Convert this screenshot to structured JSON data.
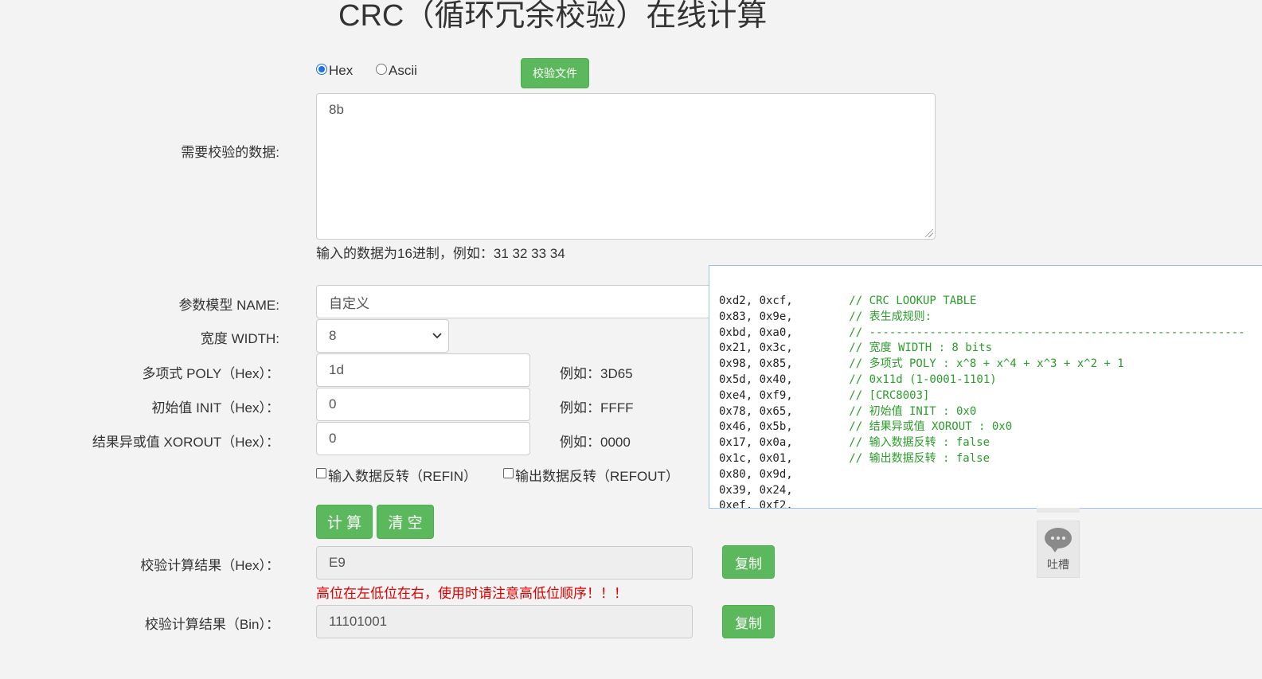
{
  "page": {
    "title": "CRC（循环冗余校验）在线计算"
  },
  "input_mode": {
    "hex_label": "Hex",
    "ascii_label": "Ascii",
    "selected": "Hex",
    "file_button": "校验文件"
  },
  "data": {
    "label": "需要校验的数据:",
    "value": "8b",
    "hint": "输入的数据为16进制，例如：31 32 33 34"
  },
  "params": {
    "name_label": "参数模型 NAME:",
    "name_value": "自定义",
    "width_label": "宽度 WIDTH:",
    "width_value": "8",
    "poly_label": "多项式 POLY（Hex）：",
    "poly_value": "1d",
    "poly_example": "例如：3D65",
    "init_label": "初始值 INIT（Hex）：",
    "init_value": "0",
    "init_example": "例如：FFFF",
    "xorout_label": "结果异或值 XOROUT（Hex）：",
    "xorout_value": "0",
    "xorout_example": "例如：0000",
    "refin_label": "输入数据反转（REFIN）",
    "refin_checked": false,
    "refout_label": "输出数据反转（REFOUT）",
    "refout_checked": false
  },
  "actions": {
    "calc": "计 算",
    "clear": "清 空"
  },
  "result": {
    "hex_label": "校验计算结果（Hex）：",
    "hex_value": "E9",
    "warning": "高位在左低位在右，使用时请注意高低位顺序！！！",
    "bin_label": "校验计算结果（Bin）：",
    "bin_value": "11101001",
    "copy_label": "复制"
  },
  "code_table": {
    "lines": [
      {
        "vals": "0xd2, 0xcf,",
        "comment": "   // CRC LOOKUP TABLE"
      },
      {
        "vals": "0x83, 0x9e,",
        "comment": "   // 表生成规则:"
      },
      {
        "vals": "0xbd, 0xa0,",
        "comment": "   // --------------------------------------------------------"
      },
      {
        "vals": "0x21, 0x3c,",
        "comment": "   // 宽度 WIDTH : 8 bits"
      },
      {
        "vals": "0x98, 0x85,",
        "comment": "   // 多项式 POLY : x^8 + x^4 + x^3 + x^2 + 1"
      },
      {
        "vals": "0x5d, 0x40,",
        "comment": "   // 0x11d (1-0001-1101)"
      },
      {
        "vals": "0xe4, 0xf9,",
        "comment": "   // [CRC8003]"
      },
      {
        "vals": "0x78, 0x65,",
        "comment": "   // 初始值 INIT : 0x0"
      },
      {
        "vals": "0x46, 0x5b,",
        "comment": "   // 结果异或值 XOROUT : 0x0"
      },
      {
        "vals": "0x17, 0x0a,",
        "comment": "   // 输入数据反转 : false"
      },
      {
        "vals": "0x1c, 0x01,",
        "comment": "   // 输出数据反转 : false"
      },
      {
        "vals": "0x80, 0x9d,",
        "comment": ""
      },
      {
        "vals": "0x39, 0x24,",
        "comment": ""
      },
      {
        "vals": "0xef, 0xf2,",
        "comment": ""
      }
    ]
  },
  "feedback": {
    "label": "吐槽",
    "icon": "chat-bubble-icon"
  },
  "colors": {
    "accent_green": "#5cb85c",
    "warning_red": "#dd0000",
    "comment_green": "#2a9d2a"
  }
}
